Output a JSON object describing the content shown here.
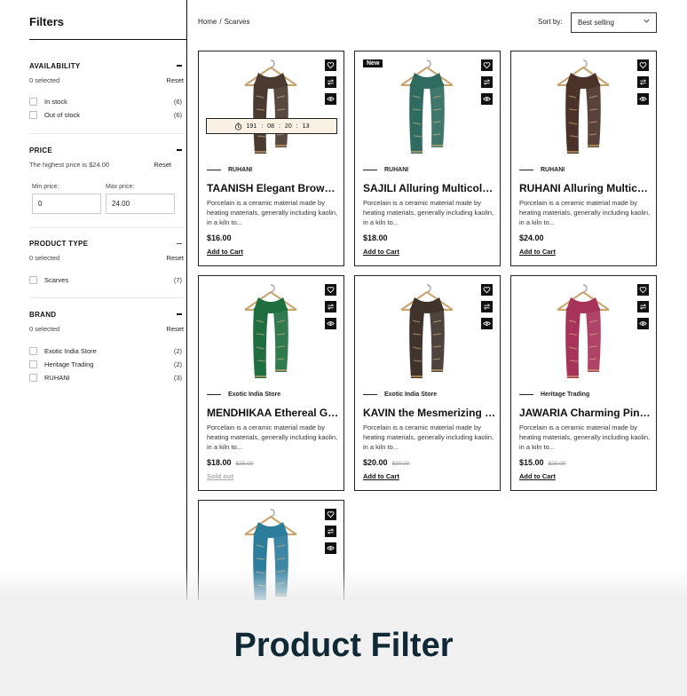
{
  "sidebar": {
    "title": "Filters",
    "availability": {
      "title": "AVAILABILITY",
      "selected": "0 selected",
      "reset": "Reset",
      "options": [
        {
          "label": "In stock",
          "count": "(6)"
        },
        {
          "label": "Out of stock",
          "count": "(6)"
        }
      ]
    },
    "price": {
      "title": "PRICE",
      "highest": "The highest price is $24.00",
      "reset": "Reset",
      "min_label": "Min price:",
      "max_label": "Max price:",
      "min_value": "0",
      "max_value": "24.00"
    },
    "product_type": {
      "title": "PRODUCT TYPE",
      "selected": "0 selected",
      "reset": "Reset",
      "options": [
        {
          "label": "Scarves",
          "count": "(7)"
        }
      ]
    },
    "brand": {
      "title": "BRAND",
      "selected": "0 selected",
      "reset": "Reset",
      "options": [
        {
          "label": "Exotic India Store",
          "count": "(2)"
        },
        {
          "label": "Heritage Trading",
          "count": "(2)"
        },
        {
          "label": "RUHANI",
          "count": "(3)"
        }
      ]
    }
  },
  "toolbar": {
    "breadcrumb": [
      "Home",
      "Scarves"
    ],
    "breadcrumb_sep": "/",
    "sort_label": "Sort by:",
    "sort_value": "Best selling"
  },
  "products": [
    {
      "vendor": "RUHANI",
      "name": "TAANISH Elegant Brown Pashmina Scarf",
      "desc": "Porcelain is a ceramic material made by heating materials, generally including kaolin, in a kiln to...",
      "price": "$16.00",
      "compare": "",
      "cart": "Add to Cart",
      "timer": [
        "191",
        "08",
        "20",
        "13"
      ],
      "timer_sep": ":",
      "color": "#4a3a30"
    },
    {
      "vendor": "RUHANI",
      "name": "SAJILI Alluring Multicolor Scarf",
      "desc": "Porcelain is a ceramic material made by heating materials, generally including kaolin, in a kiln to...",
      "price": "$18.00",
      "compare": "",
      "cart": "Add to Cart",
      "badge": "New",
      "color": "#2f6b60"
    },
    {
      "vendor": "RUHANI",
      "name": "RUHANI Alluring Multicolor Scarf",
      "desc": "Porcelain is a ceramic material made by heating materials, generally including kaolin, in a kiln to...",
      "price": "$24.00",
      "compare": "",
      "cart": "Add to Cart",
      "color": "#4b3228"
    },
    {
      "vendor": "Exotic India Store",
      "name": "MENDHIKAA Ethereal Green Scarf",
      "desc": "Porcelain is a ceramic material made by heating materials, generally including kaolin, in a kiln to...",
      "price": "$18.00",
      "compare": "$25.00",
      "cart": "Sold out",
      "sold": true,
      "color": "#1f6e40"
    },
    {
      "vendor": "Exotic India Store",
      "name": "KAVIN the Mesmerizing Scarf",
      "desc": "Porcelain is a ceramic material made by heating materials, generally including kaolin, in a kiln to...",
      "price": "$20.00",
      "compare": "$30.00",
      "cart": "Add to Cart",
      "color": "#40332c"
    },
    {
      "vendor": "Heritage Trading",
      "name": "JAWARIA Charming Pink Scarf",
      "desc": "Porcelain is a ceramic material made by heating materials, generally including kaolin, in a kiln to...",
      "price": "$15.00",
      "compare": "$20.00",
      "cart": "Add to Cart",
      "color": "#a8335a"
    },
    {
      "vendor": "",
      "name": "",
      "desc": "",
      "price": "",
      "compare": "",
      "cart": "",
      "color": "#2c7d9c"
    }
  ],
  "banner": {
    "title": "Product Filter"
  }
}
